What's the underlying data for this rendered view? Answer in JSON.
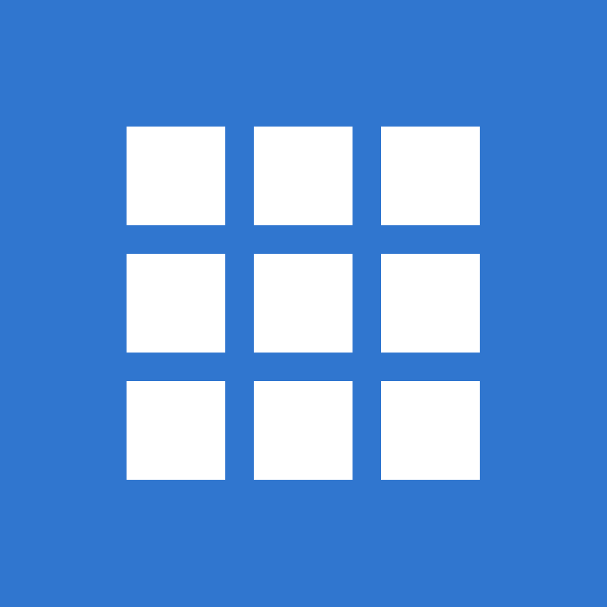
{
  "app_icon": {
    "icon": "apps-grid-icon",
    "background_color": "#3076CF",
    "tile_color": "#FFFFFF",
    "rows": 3,
    "columns": 3
  }
}
